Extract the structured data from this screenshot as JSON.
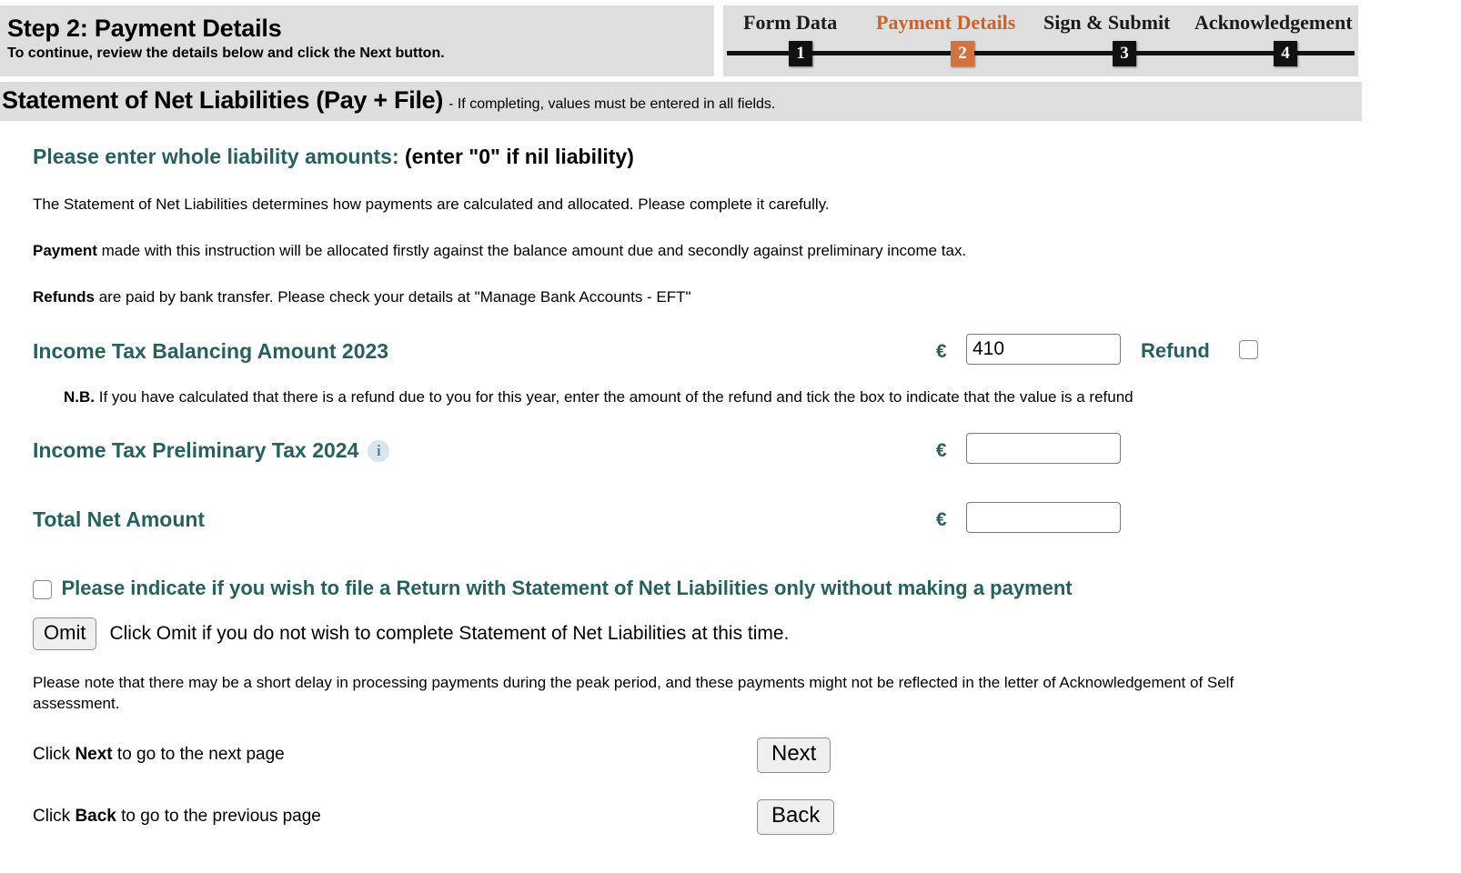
{
  "header": {
    "step_title": "Step 2: Payment Details",
    "step_subtitle": "To continue, review the details below and click the Next button.",
    "progress": {
      "steps": [
        {
          "label": "Form Data",
          "number": "1",
          "state": "complete"
        },
        {
          "label": "Payment Details",
          "number": "2",
          "state": "current"
        },
        {
          "label": "Sign & Submit",
          "number": "3",
          "state": "upcoming"
        },
        {
          "label": "Acknowledgement",
          "number": "4",
          "state": "upcoming"
        }
      ],
      "current_color": "#c8622e",
      "default_color": "#111111"
    }
  },
  "section": {
    "title": "Statement of Net Liabilities (Pay + File)",
    "note": "- If completing, values must be entered in all fields."
  },
  "main": {
    "heading_teal": "Please enter whole liability amounts:",
    "heading_black": "(enter \"0\" if nil liability)",
    "intro_paragraph": "The Statement of Net Liabilities determines how payments are calculated and allocated. Please complete it carefully.",
    "payment_label": "Payment",
    "payment_paragraph": " made with this instruction will be allocated firstly against the balance amount due and secondly against preliminary income tax.",
    "refunds_label": "Refunds",
    "refunds_paragraph": " are paid by bank transfer. Please check your details at \"Manage Bank Accounts - EFT\"",
    "balancing": {
      "label": "Income Tax Balancing Amount 2023",
      "currency": "€",
      "value": "410",
      "placeholder": "",
      "refund_label": "Refund",
      "refund_checked": false
    },
    "nb_label": "N.B.",
    "nb_text": " If you have calculated that there is a refund due to you for this year, enter the amount of the refund and tick the box to indicate that the value is a refund",
    "preliminary": {
      "label": "Income Tax Preliminary Tax 2024",
      "currency": "€",
      "value": "",
      "placeholder": "",
      "info_icon": "info-icon",
      "info_glyph": "i"
    },
    "total": {
      "label": "Total Net Amount",
      "currency": "€",
      "value": "",
      "placeholder": ""
    },
    "file_only": {
      "label": "Please indicate if you wish to file a Return with Statement of Net Liabilities only without making a payment",
      "checked": false
    },
    "omit": {
      "button_label": "Omit",
      "description": "Click Omit if you do not wish to complete Statement of Net Liabilities at this time."
    },
    "peak_note": "Please note that there may be a short delay in processing payments during the peak period, and these payments might not be reflected in the letter of Acknowledgement of Self assessment.",
    "nav": {
      "next_prefix": "Click ",
      "next_bold": "Next",
      "next_suffix": " to go to the next page",
      "next_button": "Next",
      "back_prefix": "Click ",
      "back_bold": "Back",
      "back_suffix": " to go to the previous page",
      "back_button": "Back"
    }
  },
  "colors": {
    "teal": "#27615f",
    "accent_orange": "#c8622e",
    "bar_gray": "#dedede"
  }
}
